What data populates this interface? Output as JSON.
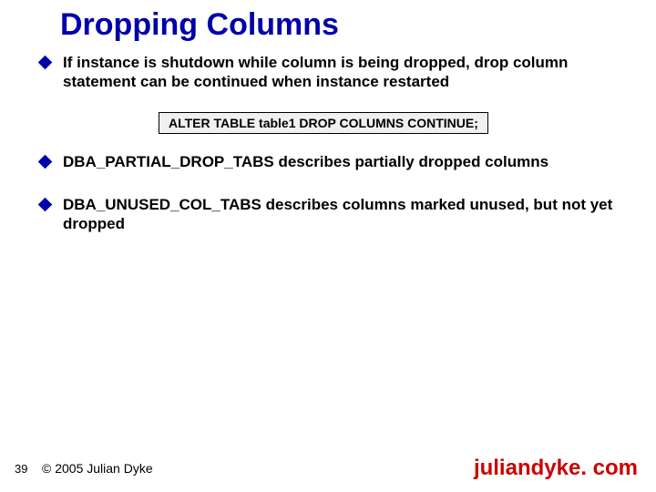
{
  "title": "Dropping Columns",
  "bullets": [
    "If instance is shutdown while column is being dropped, drop column statement can be continued when instance restarted",
    "DBA_PARTIAL_DROP_TABS describes partially dropped columns",
    "DBA_UNUSED_COL_TABS describes columns marked unused, but not yet dropped"
  ],
  "code": "ALTER TABLE table1 DROP COLUMNS CONTINUE;",
  "footer": {
    "page": "39",
    "copyright": "© 2005 Julian Dyke",
    "site": "juliandyke. com"
  }
}
